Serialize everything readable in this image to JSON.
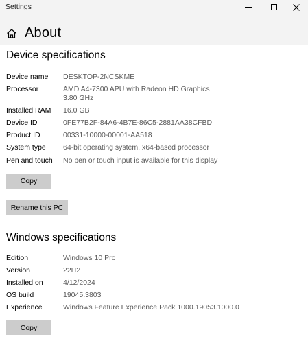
{
  "window": {
    "title": "Settings"
  },
  "page": {
    "title": "About"
  },
  "device_specs": {
    "heading": "Device specifications",
    "rows": [
      {
        "label": "Device name",
        "value": "DESKTOP-2NCSKME"
      },
      {
        "label": "Processor",
        "value_lines": [
          "AMD A4-7300 APU with Radeon HD Graphics",
          "3.80 GHz"
        ]
      },
      {
        "label": "Installed RAM",
        "value": "16.0 GB"
      },
      {
        "label": "Device ID",
        "value": "0FE77B2F-84A6-4B7E-86C5-2881AA38CFBD"
      },
      {
        "label": "Product ID",
        "value": "00331-10000-00001-AA518"
      },
      {
        "label": "System type",
        "value": "64-bit operating system, x64-based processor"
      },
      {
        "label": "Pen and touch",
        "value": "No pen or touch input is available for this display"
      }
    ],
    "copy_label": "Copy",
    "rename_label": "Rename this PC"
  },
  "windows_specs": {
    "heading": "Windows specifications",
    "rows": [
      {
        "label": "Edition",
        "value": "Windows 10 Pro"
      },
      {
        "label": "Version",
        "value": "22H2"
      },
      {
        "label": "Installed on",
        "value": "4/12/2024"
      },
      {
        "label": "OS build",
        "value": "19045.3803"
      },
      {
        "label": "Experience",
        "value": "Windows Feature Experience Pack 1000.19053.1000.0"
      }
    ],
    "copy_label": "Copy"
  },
  "icons": {
    "home": "home-icon",
    "minimize": "minimize-icon",
    "maximize": "maximize-icon",
    "close": "close-icon"
  }
}
